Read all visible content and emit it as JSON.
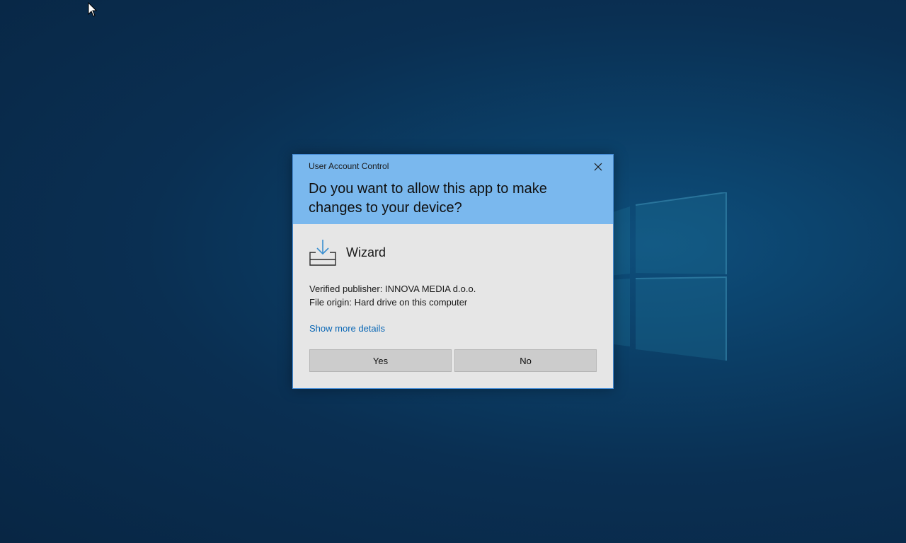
{
  "desktop": {
    "background_color": "#0b3e66"
  },
  "dialog": {
    "title": "User Account Control",
    "question": "Do you want to allow this app to make changes to your device?",
    "app_name": "Wizard",
    "app_icon": "install-download-icon",
    "publisher_line": "Verified publisher: INNOVA MEDIA d.o.o.",
    "origin_line": "File origin: Hard drive on this computer",
    "details_link": "Show more details",
    "yes_label": "Yes",
    "no_label": "No",
    "header_color": "#7ab8ee",
    "body_color": "#e6e6e6",
    "link_color": "#0a67b5"
  }
}
